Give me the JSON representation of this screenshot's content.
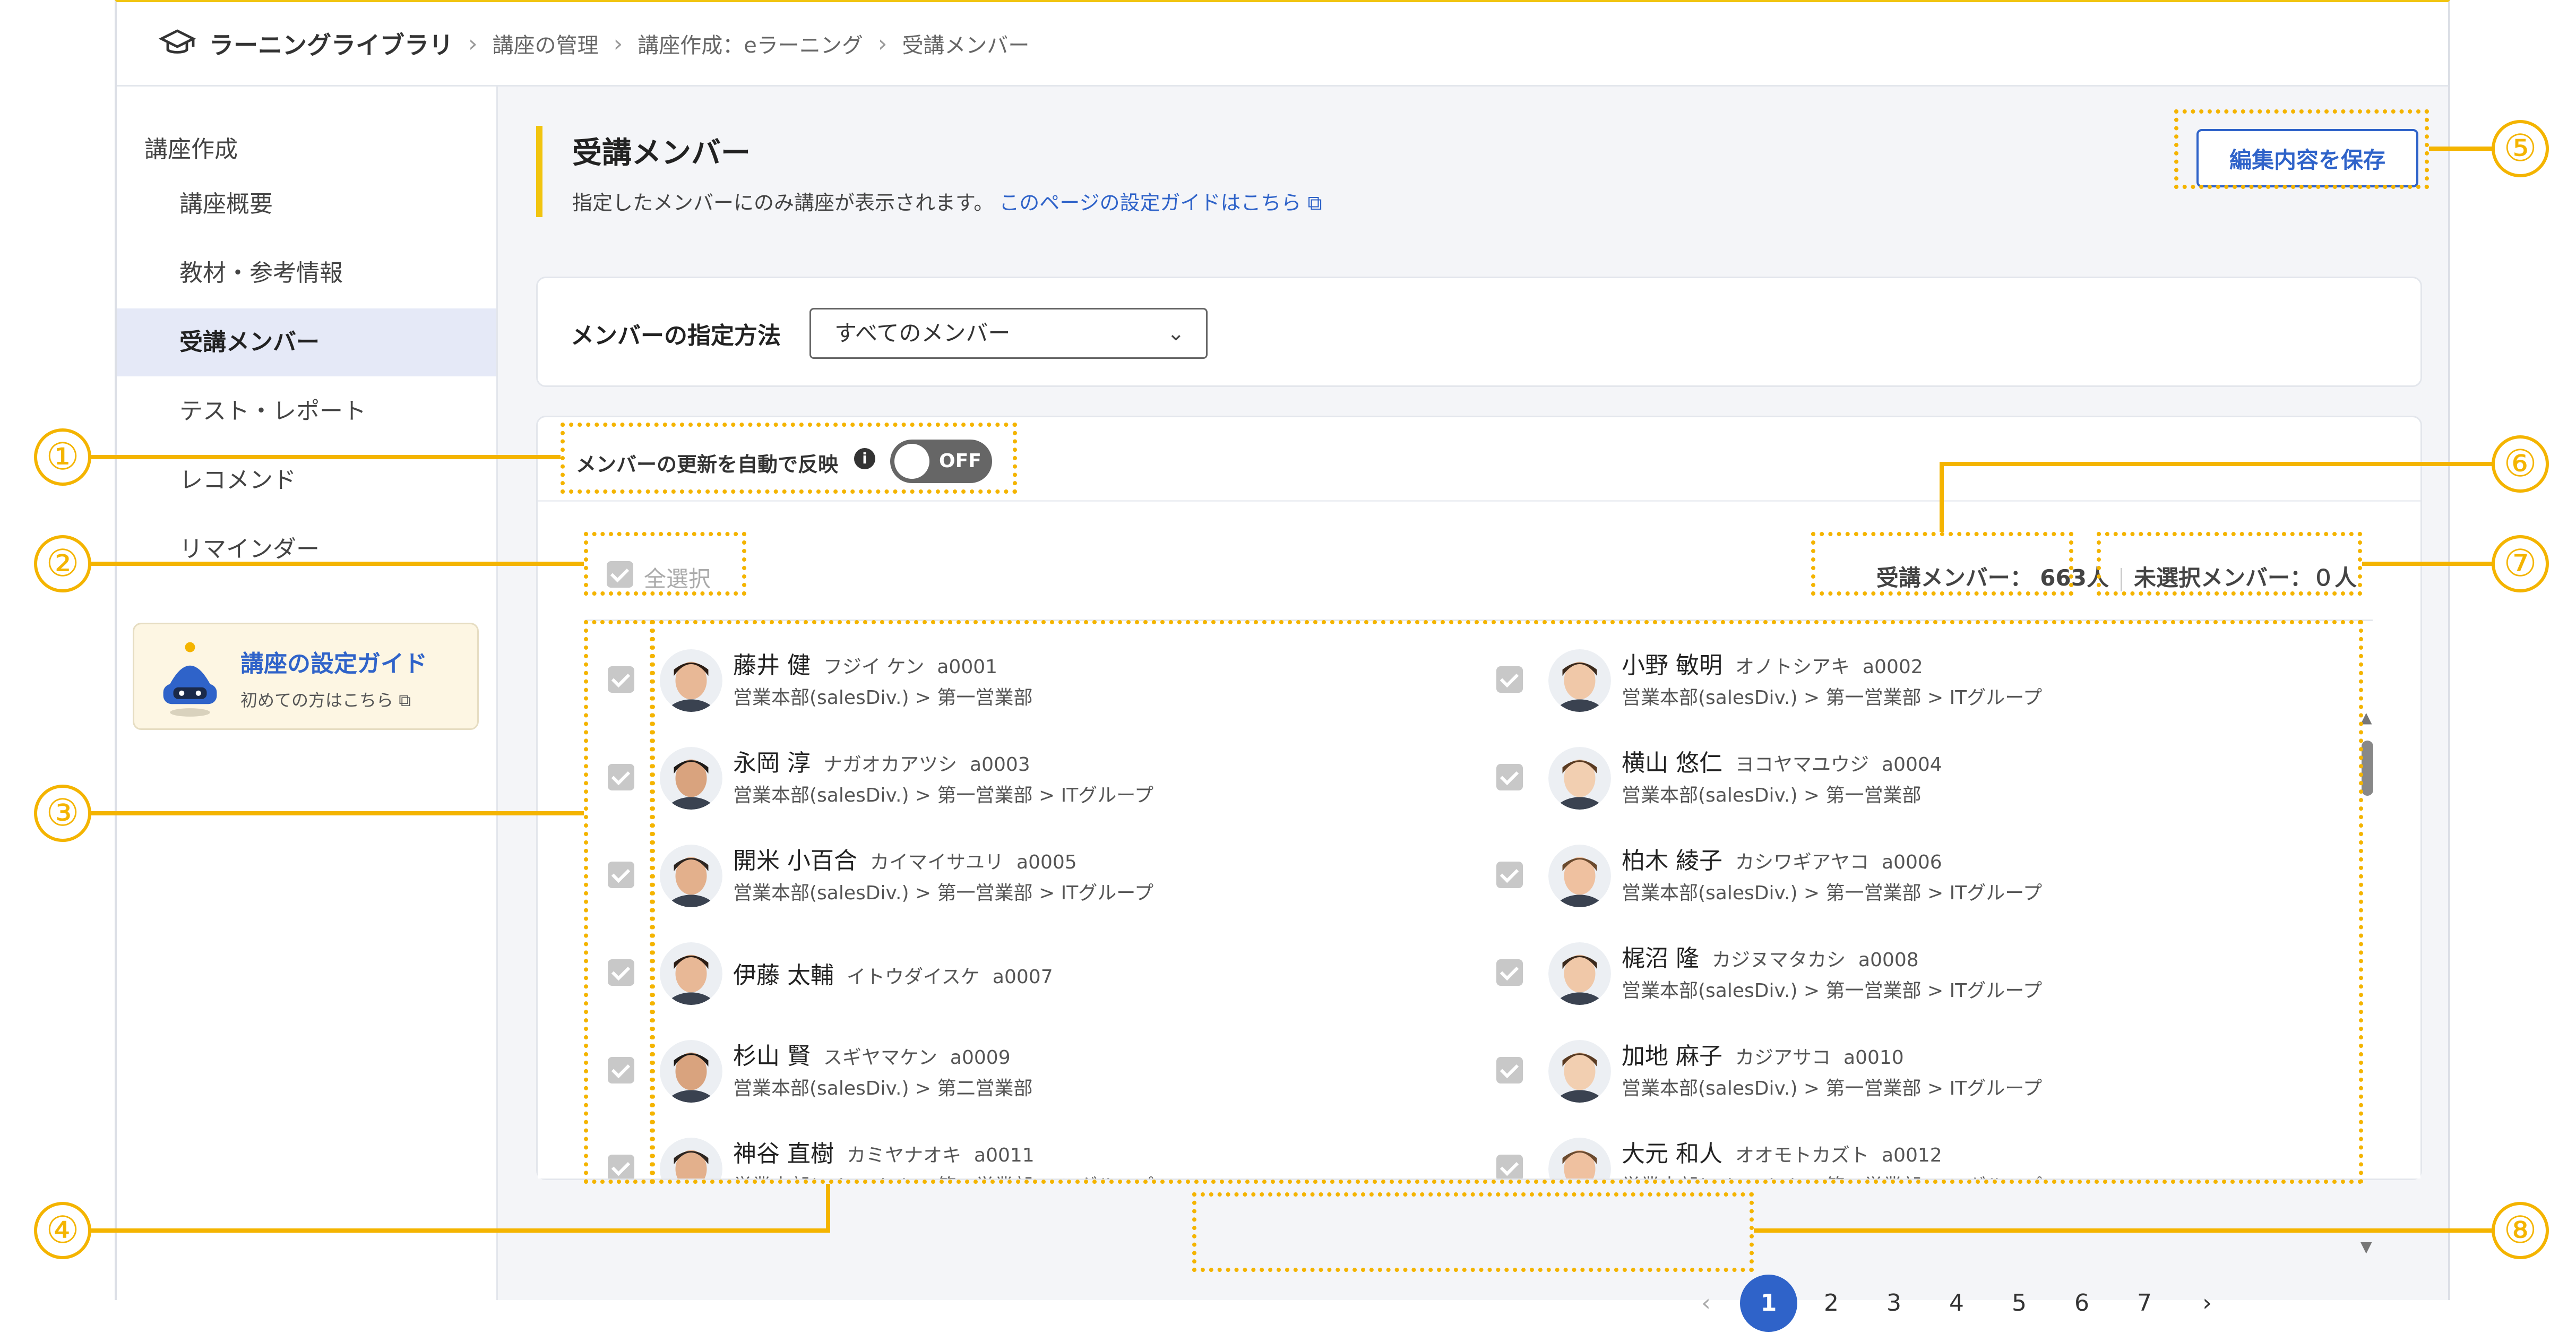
{
  "breadcrumb": {
    "brand": "ラーニングライブラリ",
    "items": [
      "講座の管理",
      "講座作成：eラーニング",
      "受講メンバー"
    ]
  },
  "sidebar": {
    "group": "講座作成",
    "items": [
      "講座概要",
      "教材・参考情報",
      "受講メンバー",
      "テスト・レポート",
      "レコメンド",
      "リマインダー"
    ],
    "guide_title": "講座の設定ガイド",
    "guide_sub": "初めての方はこちら"
  },
  "header": {
    "title": "受講メンバー",
    "description": "指定したメンバーにのみ講座が表示されます。",
    "guide_link": "このページの設定ガイドはこちら",
    "save_label": "編集内容を保存"
  },
  "method": {
    "label": "メンバーの指定方法",
    "selected": "すべてのメンバー"
  },
  "auto_reflect": {
    "label": "メンバーの更新を自動で反映",
    "toggle": "OFF"
  },
  "list": {
    "select_all": "全選択",
    "enrolled": "受講メンバー： 663人",
    "unselected": "未選択メンバー：０人",
    "members": [
      {
        "name": "藤井 健",
        "kana": "フジイ ケン",
        "id": "a0001",
        "dept": "営業本部(salesDiv.) > 第一営業部"
      },
      {
        "name": "小野 敏明",
        "kana": "オノトシアキ",
        "id": "a0002",
        "dept": "営業本部(salesDiv.) > 第一営業部 > ITグループ"
      },
      {
        "name": "永岡 淳",
        "kana": "ナガオカアツシ",
        "id": "a0003",
        "dept": "営業本部(salesDiv.) > 第一営業部 > ITグループ"
      },
      {
        "name": "横山 悠仁",
        "kana": "ヨコヤマユウジ",
        "id": "a0004",
        "dept": "営業本部(salesDiv.) > 第一営業部"
      },
      {
        "name": "開米 小百合",
        "kana": "カイマイサユリ",
        "id": "a0005",
        "dept": "営業本部(salesDiv.) > 第一営業部 > ITグループ"
      },
      {
        "name": "柏木 綾子",
        "kana": "カシワギアヤコ",
        "id": "a0006",
        "dept": "営業本部(salesDiv.) > 第一営業部 > ITグループ"
      },
      {
        "name": "伊藤 太輔",
        "kana": "イトウダイスケ",
        "id": "a0007",
        "dept": ""
      },
      {
        "name": "梶沼 隆",
        "kana": "カジヌマタカシ",
        "id": "a0008",
        "dept": "営業本部(salesDiv.) > 第一営業部 > ITグループ"
      },
      {
        "name": "杉山 賢",
        "kana": "スギヤマケン",
        "id": "a0009",
        "dept": "営業本部(salesDiv.) > 第二営業部"
      },
      {
        "name": "加地 麻子",
        "kana": "カジアサコ",
        "id": "a0010",
        "dept": "営業本部(salesDiv.) > 第一営業部 > ITグループ"
      },
      {
        "name": "神谷 直樹",
        "kana": "カミヤナオキ",
        "id": "a0011",
        "dept": "営業本部(salesDiv.) > 第一営業部 > ITグループ"
      },
      {
        "name": "大元 和人",
        "kana": "オオモトカズト",
        "id": "a0012",
        "dept": "営業本部(salesDiv.) > 第一営業部 > ITグループ"
      }
    ]
  },
  "pagination": {
    "prev": "‹",
    "next": "›",
    "pages": [
      "1",
      "2",
      "3",
      "4",
      "5",
      "6",
      "7"
    ],
    "current": "1"
  },
  "annotations": [
    "①",
    "②",
    "③",
    "④",
    "⑤",
    "⑥",
    "⑦",
    "⑧"
  ],
  "colors": {
    "accent": "#2f63c9",
    "annotation": "#f4b400",
    "active_nav": "#e5e9f7"
  }
}
